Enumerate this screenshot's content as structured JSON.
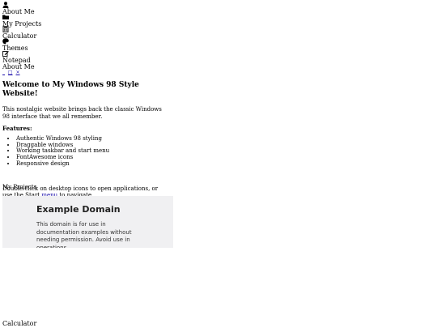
{
  "desktop": {
    "icons": [
      {
        "label": "About Me",
        "icon": "user-icon"
      },
      {
        "label": "My Projects",
        "icon": "folder-icon"
      },
      {
        "label": "Calculator",
        "icon": "calculator-icon"
      },
      {
        "label": "Themes",
        "icon": "palette-icon"
      },
      {
        "label": "Notepad",
        "icon": "edit-icon"
      }
    ]
  },
  "about_window": {
    "title": "About Me",
    "controls": [
      "_",
      "□",
      "×"
    ],
    "heading": "Welcome to My Windows 98 Style Website!",
    "intro": "This nostalgic website brings back the classic Windows 98 interface that we all remember.",
    "features_heading": "Features:",
    "features": [
      "Authentic Windows 98 styling",
      "Draggable windows",
      "Working taskbar and start menu",
      "FontAwesome icons",
      "Responsive design"
    ],
    "instructions_prefix": "Double-click on desktop icons to open applications, or use the Start ",
    "instructions_link": "menu",
    "instructions_suffix": " to navigate."
  },
  "projects_window": {
    "title": "My Projects",
    "frame_heading": "Example Domain",
    "frame_text": "This domain is for use in documentation examples without needing permission. Avoid use in operations."
  },
  "calculator_window": {
    "title": "Calculator"
  }
}
